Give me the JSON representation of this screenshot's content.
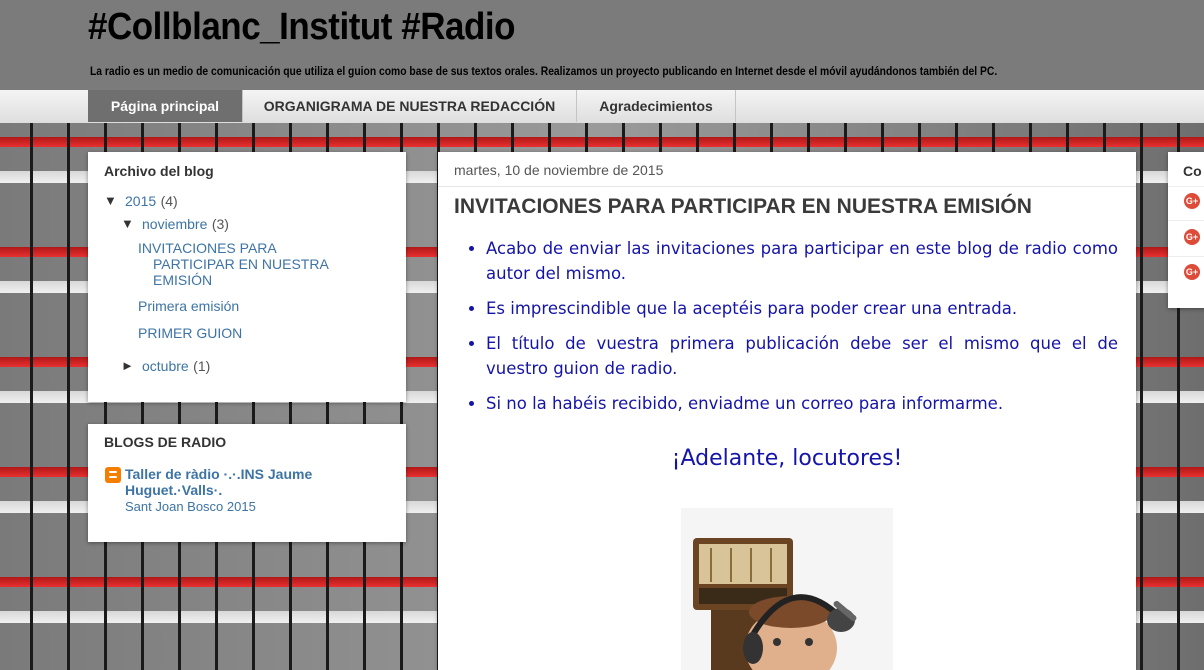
{
  "header": {
    "title": "#Collblanc_Institut #Radio",
    "description": "La radio es un medio de comunicación que utiliza el guion como base de sus textos orales. Realizamos un proyecto publicando en Internet desde el móvil ayudándonos también del PC."
  },
  "tabs": [
    {
      "label": "Página principal",
      "active": true
    },
    {
      "label": "ORGANIGRAMA DE NUESTRA REDACCIÓN",
      "active": false
    },
    {
      "label": "Agradecimientos",
      "active": false
    }
  ],
  "archive": {
    "title": "Archivo del blog",
    "year": {
      "toggle": "▼",
      "label": "2015",
      "count": "(4)"
    },
    "month_open": {
      "toggle": "▼",
      "label": "noviembre",
      "count": "(3)"
    },
    "posts": [
      {
        "line1": "INVITACIONES PARA",
        "line2": "PARTICIPAR EN NUESTRA",
        "line3": "EMISIÓN"
      },
      {
        "label": "Primera emisión"
      },
      {
        "label": "PRIMER GUION"
      }
    ],
    "month_closed": {
      "toggle": "►",
      "label": "octubre",
      "count": "(1)"
    }
  },
  "blogs": {
    "title": "BLOGS DE RADIO",
    "items": [
      {
        "line1": "Taller de ràdio ·.·.INS Jaume",
        "line2": "Huguet.·Valls·.",
        "sub": "Sant Joan Bosco 2015",
        "icon": "blogger-icon"
      }
    ]
  },
  "post": {
    "date": "martes, 10 de noviembre de 2015",
    "title": "INVITACIONES PARA PARTICIPAR EN NUESTRA EMISIÓN",
    "bullets": [
      "Acabo de enviar las invitaciones para participar en este blog de radio como autor del mismo.",
      "Es imprescindible que la aceptéis para poder crear una entrada.",
      "El título de vuestra primera publicación debe ser el mismo que el de vuestro guion de radio.",
      "Si no la habéis recibido, enviadme un correo para informarme."
    ],
    "closing": "¡Adelante, locutores!"
  },
  "right_widget": {
    "title_fragment": "Co",
    "icons": [
      "google-plus-icon",
      "google-plus-icon",
      "google-plus-icon"
    ],
    "icon_glyph": "G+"
  },
  "colors": {
    "link": "#3d74a5",
    "post_text": "#1414a8",
    "header_bg": "#7b7b7b",
    "active_tab": "#6f6f6f"
  }
}
